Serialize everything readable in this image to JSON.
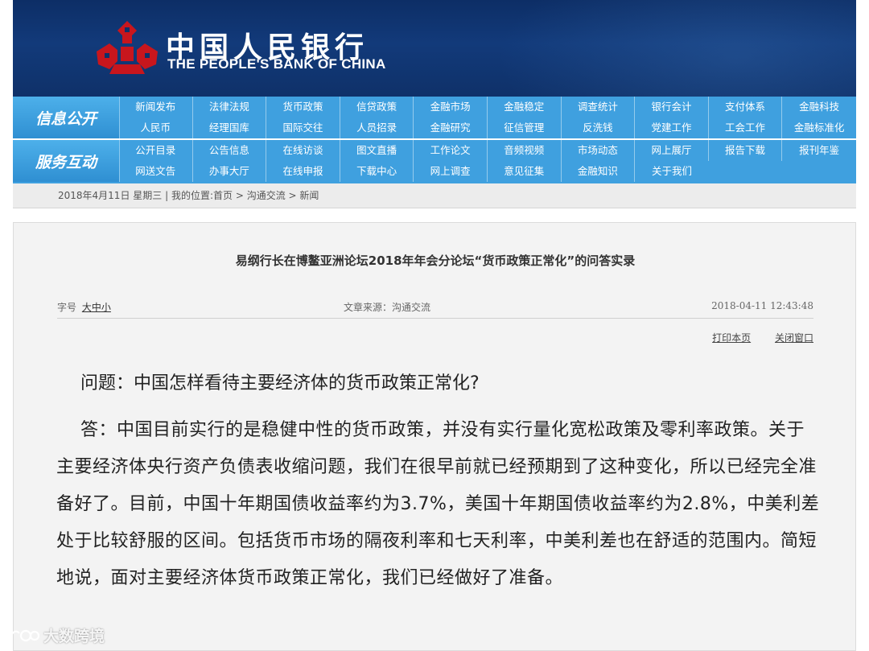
{
  "header": {
    "logo_cn": "中国人民银行",
    "logo_en": "THE PEOPLE'S BANK OF CHINA",
    "brand_color": "#c8161d"
  },
  "nav": {
    "groups": [
      {
        "title": "信息公开",
        "rows": [
          [
            "新闻发布",
            "法律法规",
            "货币政策",
            "信贷政策",
            "金融市场",
            "金融稳定",
            "调查统计",
            "银行会计",
            "支付体系",
            "金融科技"
          ],
          [
            "人民币",
            "经理国库",
            "国际交往",
            "人员招录",
            "金融研究",
            "征信管理",
            "反洗钱",
            "党建工作",
            "工会工作",
            "金融标准化"
          ]
        ]
      },
      {
        "title": "服务互动",
        "rows": [
          [
            "公开目录",
            "公告信息",
            "在线访谈",
            "图文直播",
            "工作论文",
            "音频视频",
            "市场动态",
            "网上展厅",
            "报告下载",
            "报刊年鉴"
          ],
          [
            "网送文告",
            "办事大厅",
            "在线申报",
            "下载中心",
            "网上调查",
            "意见征集",
            "金融知识",
            "关于我们"
          ]
        ]
      }
    ]
  },
  "breadcrumb": {
    "date": "2018年4月11日 星期三",
    "sep": " | ",
    "location_label": "我的位置:",
    "home": "首页",
    "arrow": " > ",
    "section": "沟通交流",
    "page": "新闻"
  },
  "article": {
    "title": "易纲行长在博鳌亚洲论坛2018年年会分论坛“货币政策正常化”的问答实录",
    "font_size_label": "字号",
    "font_large": "大",
    "font_medium": "中",
    "font_small": "小",
    "source": "文章来源：沟通交流",
    "timestamp": "2018-04-11 12:43:48",
    "print": "打印本页",
    "close": "关闭窗口",
    "question": "问题：中国怎样看待主要经济体的货币政策正常化?",
    "answer": "答：中国目前实行的是稳健中性的货币政策，并没有实行量化宽松政策及零利率政策。关于主要经济体央行资产负债表收缩问题，我们在很早前就已经预期到了这种变化，所以已经完全准备好了。目前，中国十年期国债收益率约为3.7%，美国十年期国债收益率约为2.8%，中美利差处于比较舒服的区间。包括货币市场的隔夜利率和七天利率，中美利差也在舒适的范围内。简短地说，面对主要经济体货币政策正常化，我们已经做好了准备。"
  },
  "watermark": {
    "text": "大数跨境"
  }
}
